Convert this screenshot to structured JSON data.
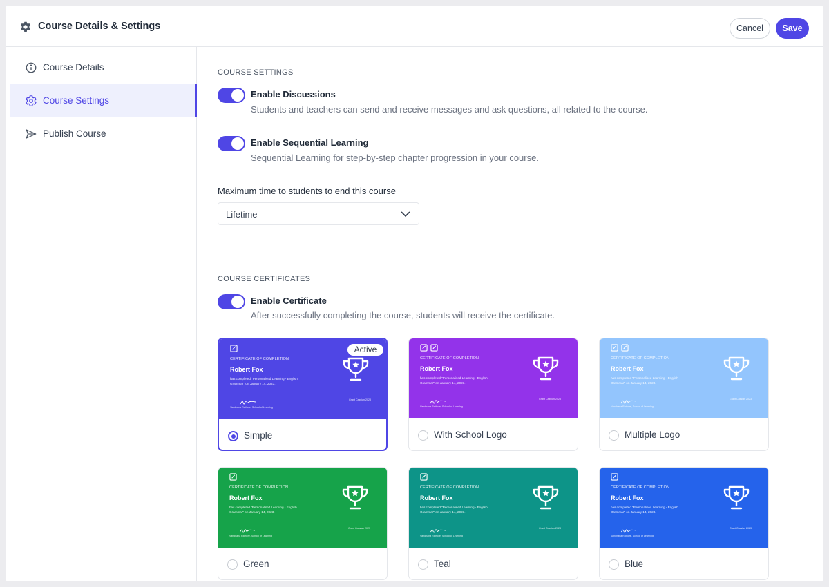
{
  "header": {
    "title": "Course Details & Settings",
    "cancel": "Cancel",
    "save": "Save",
    "icon": "gear-icon"
  },
  "sidebar": {
    "items": [
      {
        "label": "Course Details",
        "icon": "info-icon",
        "active": false
      },
      {
        "label": "Course Settings",
        "icon": "gear-icon",
        "active": true
      },
      {
        "label": "Publish Course",
        "icon": "send-icon",
        "active": false
      }
    ]
  },
  "settings": {
    "section_label": "COURSE SETTINGS",
    "discussions": {
      "title": "Enable Discussions",
      "desc": "Students and teachers can send and receive messages and ask questions, all related to the course.",
      "enabled": true
    },
    "sequential": {
      "title": "Enable Sequential Learning",
      "desc": "Sequential Learning for step-by-step chapter progression in your course.",
      "enabled": true
    },
    "max_time": {
      "label": "Maximum time to students to end this course",
      "value": "Lifetime"
    }
  },
  "certificates": {
    "section_label": "COURSE CERTIFICATES",
    "enable": {
      "title": "Enable Certificate",
      "desc": "After successfully completing the course, students will receive the certificate.",
      "enabled": true
    },
    "active_badge": "Active",
    "preview": {
      "heading": "CERTIFICATE OF COMPLETION",
      "name": "Robert Fox",
      "line1": "has completed \"Personalised Learning - English",
      "line2": "Grammar\" on January 14, 2023.",
      "signer": "Vandhana Rathore, School of Learning",
      "signer2": "Grant Cassian 2023"
    },
    "options": [
      {
        "name": "Simple",
        "color": "#4f46e5",
        "selected": true,
        "logos": 1
      },
      {
        "name": "With School Logo",
        "color": "#9333ea",
        "selected": false,
        "logos": 2
      },
      {
        "name": "Multiple Logo",
        "color": "#93c5fd",
        "selected": false,
        "logos": 2
      },
      {
        "name": "Green",
        "color": "#16a34a",
        "selected": false,
        "logos": 1
      },
      {
        "name": "Teal",
        "color": "#0d9488",
        "selected": false,
        "logos": 1
      },
      {
        "name": "Blue",
        "color": "#2563eb",
        "selected": false,
        "logos": 1
      }
    ]
  }
}
